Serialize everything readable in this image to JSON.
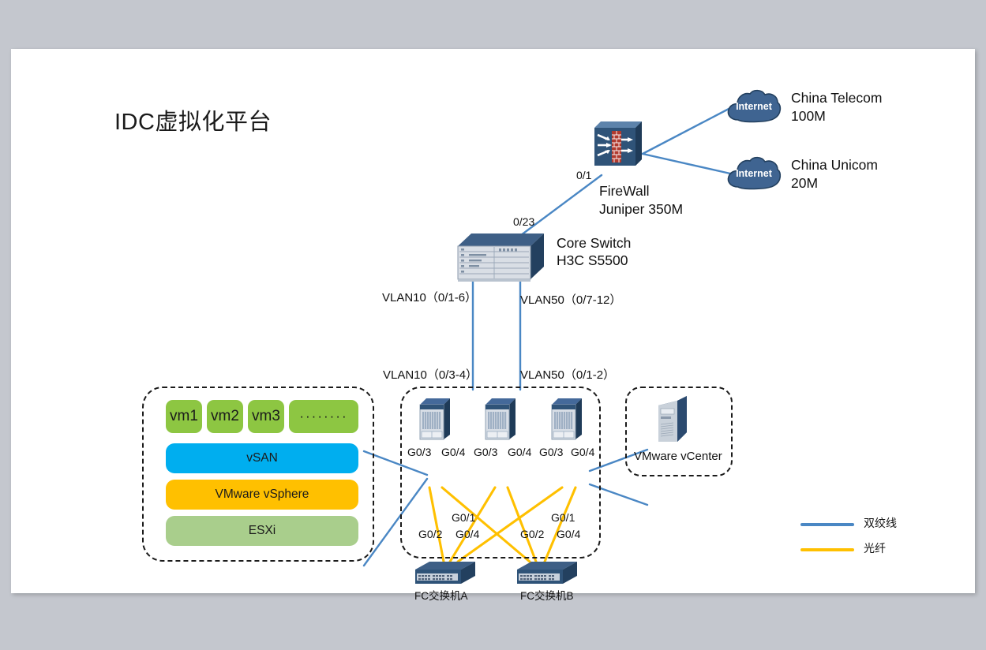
{
  "title": "IDC虚拟化平台",
  "colors": {
    "twisted_pair": "#4a87c4",
    "fiber": "#ffc000",
    "device_dark": "#2b4a6f",
    "vm_green": "#8dc642",
    "vsan_blue": "#00aeef",
    "vsphere_amber": "#ffc000",
    "esxi_green": "#a9ce8c",
    "page_bg": "#ffffff",
    "app_bg": "#c4c7ce"
  },
  "internet": {
    "cloud_label": "Internet",
    "links": [
      {
        "name": "China Telecom",
        "speed": "100M"
      },
      {
        "name": "China Unicom",
        "speed": "20M"
      }
    ]
  },
  "firewall": {
    "name": "FireWall",
    "model": "Juniper 350M",
    "port": "0/1",
    "icon": "firewall-icon"
  },
  "core_switch": {
    "name": "Core Switch",
    "model": "H3C S5500",
    "uplink_port": "0/23",
    "icon": "switch-chassis-icon"
  },
  "vlan_labels": {
    "core_left": "VLAN10（0/1-6）",
    "core_right": "VLAN50（0/7-12）",
    "host_left": "VLAN10（0/3-4）",
    "host_right": "VLAN50（0/1-2）"
  },
  "virtualization_stack": {
    "vms": [
      "vm1",
      "vm2",
      "vm3",
      "········"
    ],
    "layers": [
      {
        "label": "vSAN",
        "color": "#00aeef"
      },
      {
        "label": "VMware vSphere",
        "color": "#ffc000"
      },
      {
        "label": "ESXi",
        "color": "#a9ce8c"
      }
    ]
  },
  "servers": [
    {
      "id": "server-1",
      "ports": [
        "G0/3",
        "G0/4"
      ]
    },
    {
      "id": "server-2",
      "ports": [
        "G0/3",
        "G0/4"
      ]
    },
    {
      "id": "server-3",
      "ports": [
        "G0/3",
        "G0/4"
      ]
    }
  ],
  "fc_switches": [
    {
      "name": "FC交换机A",
      "ports": [
        "G0/2",
        "G0/1",
        "G0/4"
      ]
    },
    {
      "name": "FC交换机B",
      "ports": [
        "G0/2",
        "G0/1",
        "G0/4"
      ]
    }
  ],
  "vcenter": {
    "label": "VMware vCenter",
    "icon": "server-tower-icon"
  },
  "legend": [
    {
      "label": "双绞线",
      "color": "#4a87c4"
    },
    {
      "label": "光纤",
      "color": "#ffc000"
    }
  ]
}
